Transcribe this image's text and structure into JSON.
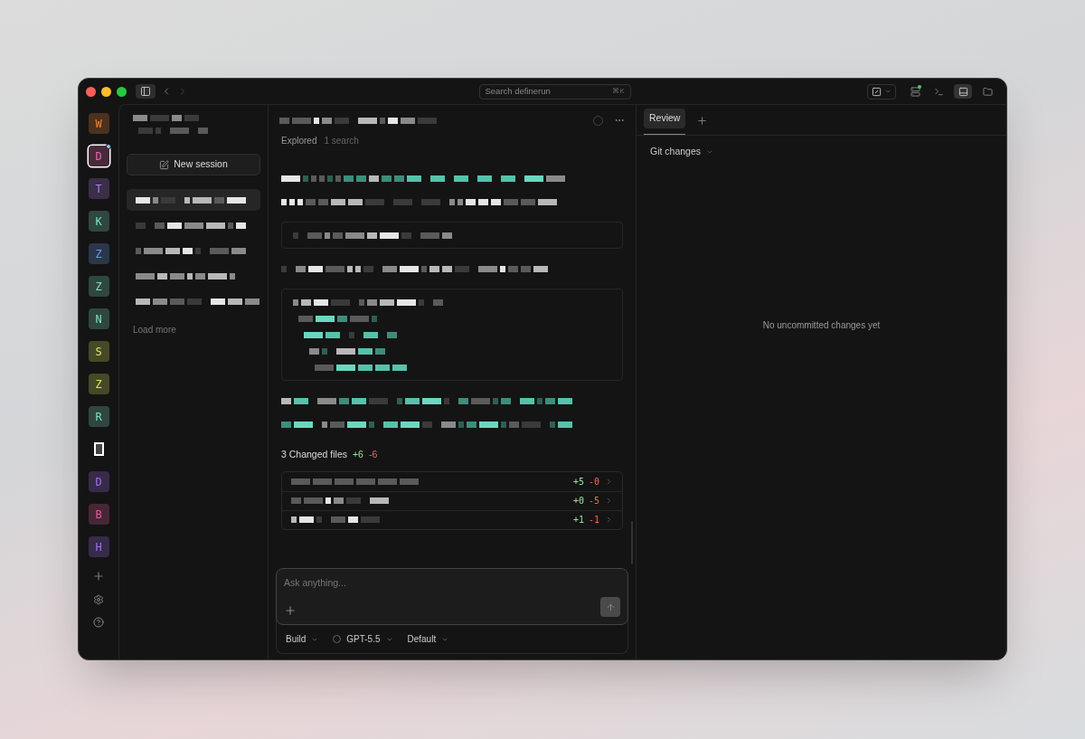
{
  "titlebar": {
    "search": {
      "placeholder": "Search definerun",
      "shortcut": "⌘K"
    }
  },
  "projects": [
    {
      "letter": "W",
      "color": "#f0873a",
      "selected": false,
      "badge": false,
      "kind": "letter"
    },
    {
      "letter": "D",
      "color": "#e46ab0",
      "selected": true,
      "badge": true,
      "kind": "letter"
    },
    {
      "letter": "T",
      "color": "#b07ae8",
      "selected": false,
      "badge": false,
      "kind": "letter"
    },
    {
      "letter": "K",
      "color": "#7fe0c4",
      "selected": false,
      "badge": false,
      "kind": "letter"
    },
    {
      "letter": "Z",
      "color": "#6a9cf0",
      "selected": false,
      "badge": false,
      "kind": "letter"
    },
    {
      "letter": "Z",
      "color": "#7fe0c4",
      "selected": false,
      "badge": false,
      "kind": "letter"
    },
    {
      "letter": "N",
      "color": "#7fe0c4",
      "selected": false,
      "badge": false,
      "kind": "letter"
    },
    {
      "letter": "S",
      "color": "#d8e860",
      "selected": false,
      "badge": false,
      "kind": "letter"
    },
    {
      "letter": "Z",
      "color": "#d8e860",
      "selected": false,
      "badge": false,
      "kind": "letter"
    },
    {
      "letter": "R",
      "color": "#7fe0c4",
      "selected": false,
      "badge": false,
      "kind": "letter"
    },
    {
      "kind": "logo",
      "selected": false
    },
    {
      "letter": "D",
      "color": "#a070e8",
      "selected": false,
      "badge": false,
      "kind": "letter"
    },
    {
      "letter": "B",
      "color": "#e45a9a",
      "selected": false,
      "badge": false,
      "kind": "letter"
    },
    {
      "letter": "H",
      "color": "#a070e8",
      "selected": false,
      "badge": false,
      "kind": "letter"
    }
  ],
  "sidebar": {
    "new_session": "New session",
    "sessions": [
      {
        "selected": true
      },
      {
        "selected": false
      },
      {
        "selected": false
      },
      {
        "selected": false
      },
      {
        "selected": false
      }
    ],
    "load_more": "Load more"
  },
  "chat": {
    "explored": {
      "label": "Explored",
      "detail": "1 search"
    },
    "blocks": [
      {
        "kind": "line",
        "highlighted": true
      },
      {
        "kind": "line",
        "highlighted": false
      },
      {
        "kind": "code",
        "lines": [
          {
            "highlighted": false
          }
        ]
      },
      {
        "kind": "line",
        "highlighted": false
      },
      {
        "kind": "code",
        "lines": [
          {
            "highlighted": false
          },
          {
            "highlighted": true
          },
          {
            "highlighted": true
          },
          {
            "highlighted": true
          },
          {
            "highlighted": true
          }
        ]
      },
      {
        "kind": "line",
        "highlighted": true
      },
      {
        "kind": "line",
        "highlighted": true
      }
    ],
    "changes": {
      "title": "3 Changed files",
      "added": "+6",
      "removed": "-6",
      "files": [
        {
          "added": "+5",
          "removed": "-0"
        },
        {
          "added": "+0",
          "removed": "-5"
        },
        {
          "added": "+1",
          "removed": "-1"
        }
      ]
    },
    "composer": {
      "placeholder": "Ask anything...",
      "send_disabled": true
    },
    "options": [
      {
        "label": "Build",
        "kind": "plain"
      },
      {
        "label": "GPT-5.5",
        "kind": "model"
      },
      {
        "label": "Default",
        "kind": "plain"
      }
    ]
  },
  "review": {
    "tabs": [
      {
        "label": "Review",
        "selected": true
      }
    ],
    "git_changes": "Git changes",
    "empty": "No uncommitted changes yet"
  }
}
